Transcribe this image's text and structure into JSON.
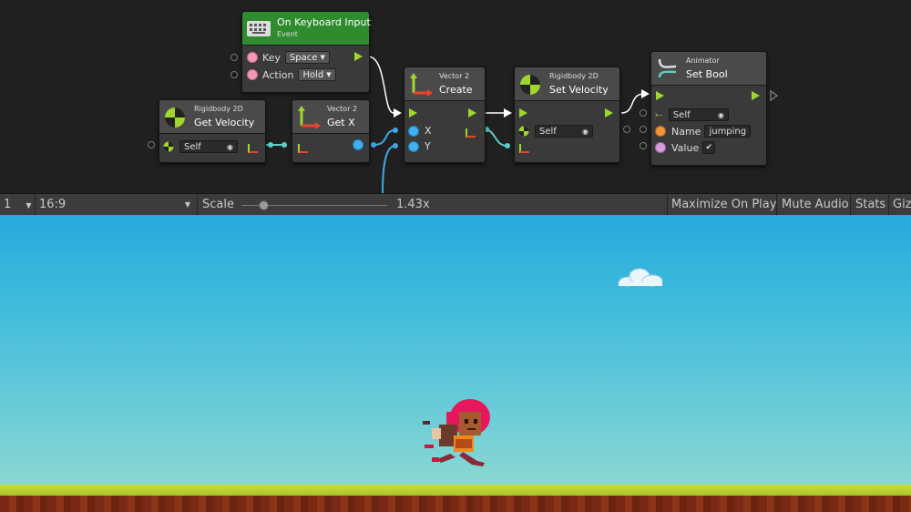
{
  "graph": {
    "nodes": {
      "keyboard": {
        "title": "On Keyboard Input",
        "subtitle": "Event",
        "key_label": "Key",
        "key_value": "Space",
        "action_label": "Action",
        "action_value": "Hold"
      },
      "getvel": {
        "subtitle": "Rigidbody 2D",
        "title": "Get Velocity",
        "target_value": "Self"
      },
      "getx": {
        "subtitle": "Vector 2",
        "title": "Get X"
      },
      "create": {
        "subtitle": "Vector 2",
        "title": "Create",
        "x_label": "X",
        "y_label": "Y"
      },
      "setvel": {
        "subtitle": "Rigidbody 2D",
        "title": "Set Velocity",
        "target_value": "Self"
      },
      "setbool": {
        "subtitle": "Animator",
        "title": "Set Bool",
        "target_value": "Self",
        "name_label": "Name",
        "name_value": "jumping",
        "value_label": "Value",
        "value_checked": "✔"
      }
    },
    "colors": {
      "background": "#202020",
      "event_header": "#2e8b2e",
      "flow_arrow": "#9fd72d",
      "vector_wire": "#5ad0c8",
      "float_wire": "#3fa9e6",
      "flow_wire": "#ffffff"
    }
  },
  "toolbar": {
    "display": "1",
    "aspect": "16:9",
    "scale_label": "Scale",
    "scale_value": "1.43x",
    "maximize": "Maximize On Play",
    "mute": "Mute Audio",
    "stats": "Stats",
    "gizmos": "Giz"
  },
  "game": {
    "sky_top": "#26aadc",
    "sky_bottom": "#95dccf",
    "ground_grass": "#b7cf2b",
    "ground_dirt": "#7a2a14",
    "icons": [
      "cloud-icon",
      "player-character-sprite"
    ]
  }
}
